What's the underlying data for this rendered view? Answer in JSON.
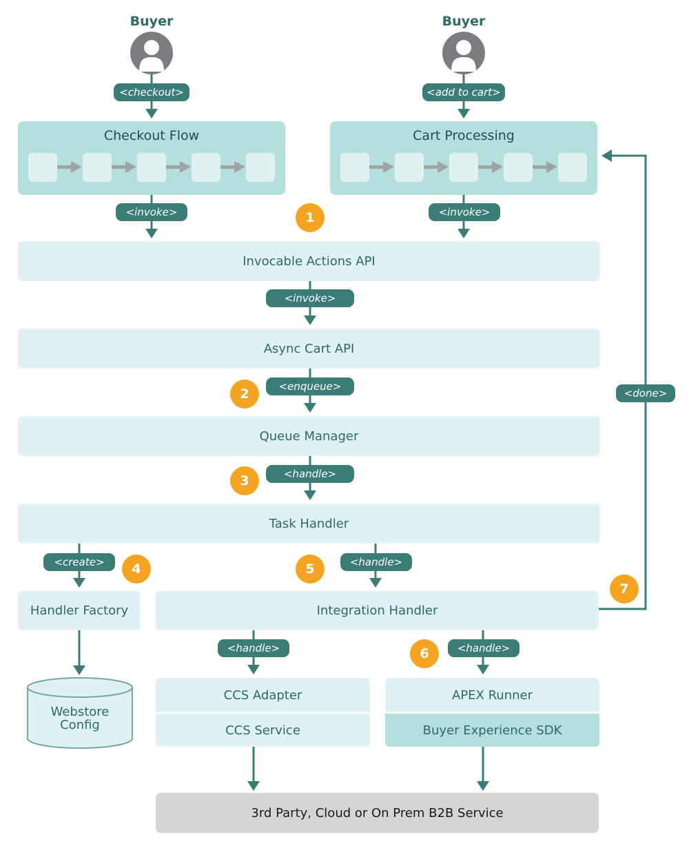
{
  "diagram": {
    "actors": [
      {
        "label": "Buyer",
        "icon": "user-avatar-icon",
        "action": "<checkout>"
      },
      {
        "label": "Buyer",
        "icon": "user-avatar-icon",
        "action": "<add to cart>"
      }
    ],
    "flows": [
      {
        "title": "Checkout Flow",
        "steps": 5,
        "edge_label": "<invoke>"
      },
      {
        "title": "Cart Processing",
        "steps": 5,
        "edge_label": "<invoke>"
      }
    ],
    "layers": {
      "invocable_actions": "Invocable Actions API",
      "invoke_label": "<invoke>",
      "async_cart": "Async Cart API",
      "enqueue_label": "<enqueue>",
      "queue_manager": "Queue Manager",
      "handle_label_1": "<handle>",
      "task_handler": "Task Handler",
      "create_label": "<create>",
      "handler_factory": "Handler Factory",
      "webstore_config_line1": "Webstore",
      "webstore_config_line2": "Config",
      "handle_label_2": "<handle>",
      "integration_handler": "Integration Handler",
      "handle_label_3": "<handle>",
      "handle_label_4": "<handle>",
      "ccs_adapter": "CCS Adapter",
      "ccs_service": "CCS Service",
      "apex_runner": "APEX Runner",
      "buyer_sdk": "Buyer Experience SDK",
      "third_party": "3rd Party, Cloud or On Prem B2B Service",
      "done_label": "<done>"
    },
    "step_badges": [
      "1",
      "2",
      "3",
      "4",
      "5",
      "6",
      "7"
    ],
    "colors": {
      "teal_dark": "#3b7d76",
      "teal_text": "#2d6a66",
      "box_light": "#dff1f4",
      "box_mid": "#b5dfdd",
      "badge_orange": "#f4a420",
      "avatar_gray": "#7b7c7f",
      "external_gray": "#d4d5d6"
    }
  }
}
